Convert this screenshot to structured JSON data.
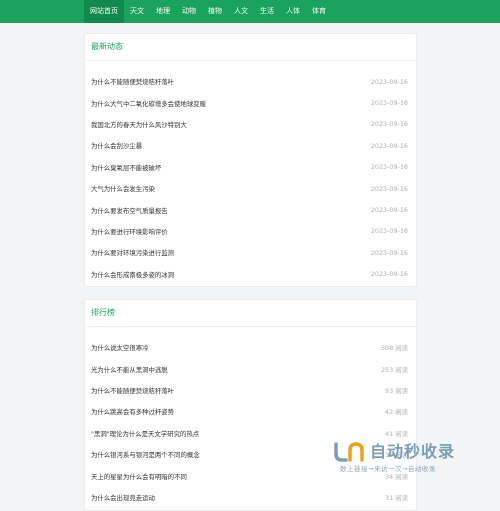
{
  "nav": {
    "items": [
      {
        "label": "网站首页",
        "active": true
      },
      {
        "label": "天文"
      },
      {
        "label": "地理"
      },
      {
        "label": "动物"
      },
      {
        "label": "植物"
      },
      {
        "label": "人文"
      },
      {
        "label": "生活"
      },
      {
        "label": "人体"
      },
      {
        "label": "体育"
      }
    ]
  },
  "news": {
    "title": "最新动态",
    "items": [
      {
        "title": "为什么不能随便焚烧秸秆落叶",
        "date": "2023-09-16"
      },
      {
        "title": "为什么大气中二氧化碳增多会使地球变暖",
        "date": "2023-09-16"
      },
      {
        "title": "我国北方的春天为什么风沙特别大",
        "date": "2023-09-16"
      },
      {
        "title": "为什么会刮沙尘暴",
        "date": "2023-09-16"
      },
      {
        "title": "为什么臭氧层不能被破坏",
        "date": "2023-09-16"
      },
      {
        "title": "大气为什么会发生污染",
        "date": "2023-09-16"
      },
      {
        "title": "为什么要发布空气质量报告",
        "date": "2023-09-16"
      },
      {
        "title": "为什么要进行环境影响评价",
        "date": "2023-09-16"
      },
      {
        "title": "为什么要对环境污染进行监测",
        "date": "2023-09-16"
      },
      {
        "title": "为什么会形成南极多姿的冰洞",
        "date": "2023-09-16"
      }
    ]
  },
  "rank": {
    "title": "排行榜",
    "items": [
      {
        "title": "为什么说太空很寒冷",
        "views": "308 阅读"
      },
      {
        "title": "光为什么不能从黑洞中逃脱",
        "views": "253 阅读"
      },
      {
        "title": "为什么不能随便焚烧秸秆落叶",
        "views": "93 阅读"
      },
      {
        "title": "为什么跳高会有多种过杆姿势",
        "views": "42 阅读"
      },
      {
        "title": "\"黑洞\"理论为什么是天文学研究的热点",
        "views": "41 阅读"
      },
      {
        "title": "为什么银河系与银河是两个不同的概念",
        "views": "38 阅读"
      },
      {
        "title": "天上的星星为什么会有明暗的不同",
        "views": "34 阅读"
      },
      {
        "title": "为什么会出现竞走运动",
        "views": "31 阅读"
      }
    ]
  },
  "watermark": {
    "text": "自动秒收录",
    "subtext": "数上链接→来访一次→自动收录",
    "color": "#7a9fb5"
  }
}
